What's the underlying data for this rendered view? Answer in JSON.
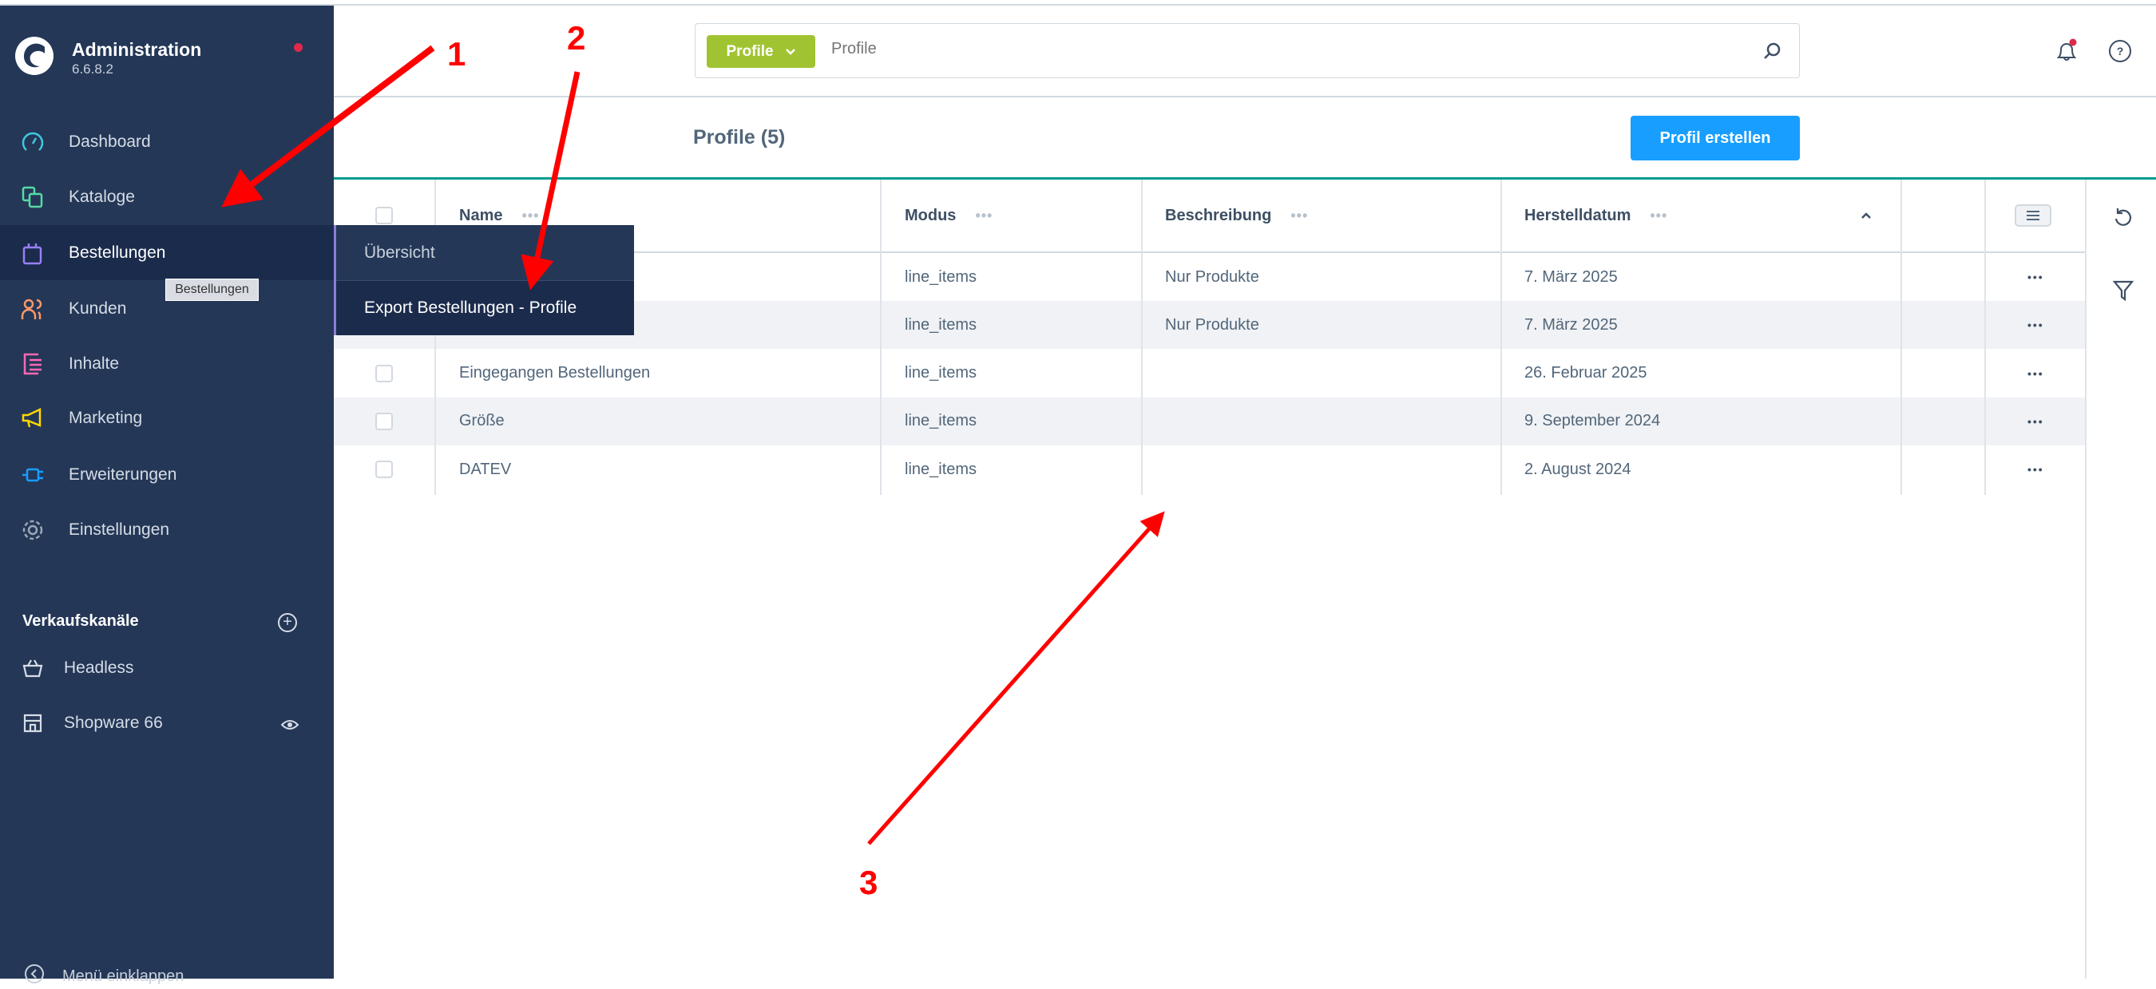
{
  "app": {
    "name": "Administration",
    "version": "6.6.8.2"
  },
  "sidebar": {
    "items": [
      {
        "label": "Dashboard",
        "icon": "gauge-icon",
        "color": "#3fc8e0"
      },
      {
        "label": "Kataloge",
        "icon": "catalog-icon",
        "color": "#57d9a3"
      },
      {
        "label": "Bestellungen",
        "icon": "shopping-bag-icon",
        "color": "#9a7ff5"
      },
      {
        "label": "Kunden",
        "icon": "users-icon",
        "color": "#ff9966"
      },
      {
        "label": "Inhalte",
        "icon": "content-icon",
        "color": "#ff68b4"
      },
      {
        "label": "Marketing",
        "icon": "megaphone-icon",
        "color": "#ffd700"
      },
      {
        "label": "Erweiterungen",
        "icon": "plug-icon",
        "color": "#189eff"
      },
      {
        "label": "Einstellungen",
        "icon": "gear-icon",
        "color": "#9aa8b5"
      }
    ],
    "tooltip": "Bestellungen",
    "sales_channels_title": "Verkaufskanäle",
    "channels": [
      {
        "label": "Headless",
        "icon": "basket-icon"
      },
      {
        "label": "Shopware 66",
        "icon": "storefront-icon"
      }
    ],
    "collapse_label": "Menü einklappen"
  },
  "flyout": {
    "items": [
      "Übersicht",
      "Export Bestellungen - Profile"
    ]
  },
  "header": {
    "search_type": "Profile",
    "search_placeholder": "Profile"
  },
  "page": {
    "title": "Profile (5)",
    "create_button": "Profil erstellen"
  },
  "table": {
    "columns": [
      "Name",
      "Modus",
      "Beschreibung",
      "Herstelldatum"
    ],
    "rows": [
      {
        "name": "",
        "mode": "line_items",
        "description": "Nur Produkte",
        "date": "7. März 2025"
      },
      {
        "name": "",
        "mode": "line_items",
        "description": "Nur Produkte",
        "date": "7. März 2025"
      },
      {
        "name": "Eingegangen Bestellungen",
        "mode": "line_items",
        "description": "",
        "date": "26. Februar 2025"
      },
      {
        "name": "Größe",
        "mode": "line_items",
        "description": "",
        "date": "9. September 2024"
      },
      {
        "name": "DATEV",
        "mode": "line_items",
        "description": "",
        "date": "2. August 2024"
      }
    ],
    "row_action": "•••"
  },
  "annotations": {
    "labels": [
      "1",
      "2",
      "3"
    ],
    "color": "#ff0000"
  },
  "colors": {
    "sidebar": "#243757",
    "accent": "#189eff",
    "teal": "#009c8d",
    "search_type": "#a0c431"
  }
}
